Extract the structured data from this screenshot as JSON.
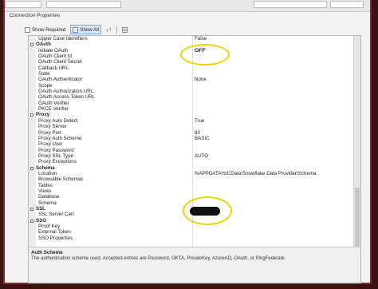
{
  "top_fields": [
    "",
    "",
    ""
  ],
  "section_title": "Connection Properties",
  "toolbar": {
    "show_required": "Show Required",
    "show_all": "Show All"
  },
  "grid": {
    "rows": [
      {
        "type": "prop",
        "name": "Upper Case Identifiers",
        "value": "False"
      },
      {
        "type": "cat",
        "name": "OAuth"
      },
      {
        "type": "prop",
        "name": "Initiate OAuth",
        "value": "OFF"
      },
      {
        "type": "prop",
        "name": "OAuth Client Id",
        "value": ""
      },
      {
        "type": "prop",
        "name": "OAuth Client Secret",
        "value": ""
      },
      {
        "type": "prop",
        "name": "Callback URL",
        "value": ""
      },
      {
        "type": "prop",
        "name": "State",
        "value": ""
      },
      {
        "type": "prop",
        "name": "OAuth Authenticator",
        "value": "None"
      },
      {
        "type": "prop",
        "name": "Scope",
        "value": ""
      },
      {
        "type": "prop",
        "name": "OAuth Authorization URL",
        "value": ""
      },
      {
        "type": "prop",
        "name": "OAuth Access Token URL",
        "value": ""
      },
      {
        "type": "prop",
        "name": "OAuth Verifier",
        "value": ""
      },
      {
        "type": "prop",
        "name": "PKCE Verifier",
        "value": ""
      },
      {
        "type": "cat",
        "name": "Proxy"
      },
      {
        "type": "prop",
        "name": "Proxy Auto Detect",
        "value": "True"
      },
      {
        "type": "prop",
        "name": "Proxy Server",
        "value": ""
      },
      {
        "type": "prop",
        "name": "Proxy Port",
        "value": "80"
      },
      {
        "type": "prop",
        "name": "Proxy Auth Scheme",
        "value": "BASIC"
      },
      {
        "type": "prop",
        "name": "Proxy User",
        "value": ""
      },
      {
        "type": "prop",
        "name": "Proxy Password",
        "value": ""
      },
      {
        "type": "prop",
        "name": "Proxy SSL Type",
        "value": "AUTO"
      },
      {
        "type": "prop",
        "name": "Proxy Exceptions",
        "value": ""
      },
      {
        "type": "cat",
        "name": "Schema"
      },
      {
        "type": "prop",
        "name": "Location",
        "value": "%APPDATA%\\CData\\Snowflake Data Provider\\Schema"
      },
      {
        "type": "prop",
        "name": "Browsable Schemas",
        "value": ""
      },
      {
        "type": "prop",
        "name": "Tables",
        "value": ""
      },
      {
        "type": "prop",
        "name": "Views",
        "value": ""
      },
      {
        "type": "prop",
        "name": "Database",
        "value": ""
      },
      {
        "type": "prop",
        "name": "Schema",
        "value": ""
      },
      {
        "type": "cat",
        "name": "SSL"
      },
      {
        "type": "prop",
        "name": "SSL Server Cert",
        "value": ""
      },
      {
        "type": "cat",
        "name": "SSO"
      },
      {
        "type": "prop",
        "name": "Proof Key",
        "value": ""
      },
      {
        "type": "prop",
        "name": "External Token",
        "value": ""
      },
      {
        "type": "prop",
        "name": "SSO Properties",
        "value": ""
      }
    ]
  },
  "description": {
    "title": "Auth Scheme",
    "text": "The authentication scheme used. Accepted entries are Password, OKTA, PrivateKey, AzureAD, OAuth, or PingFederate."
  }
}
